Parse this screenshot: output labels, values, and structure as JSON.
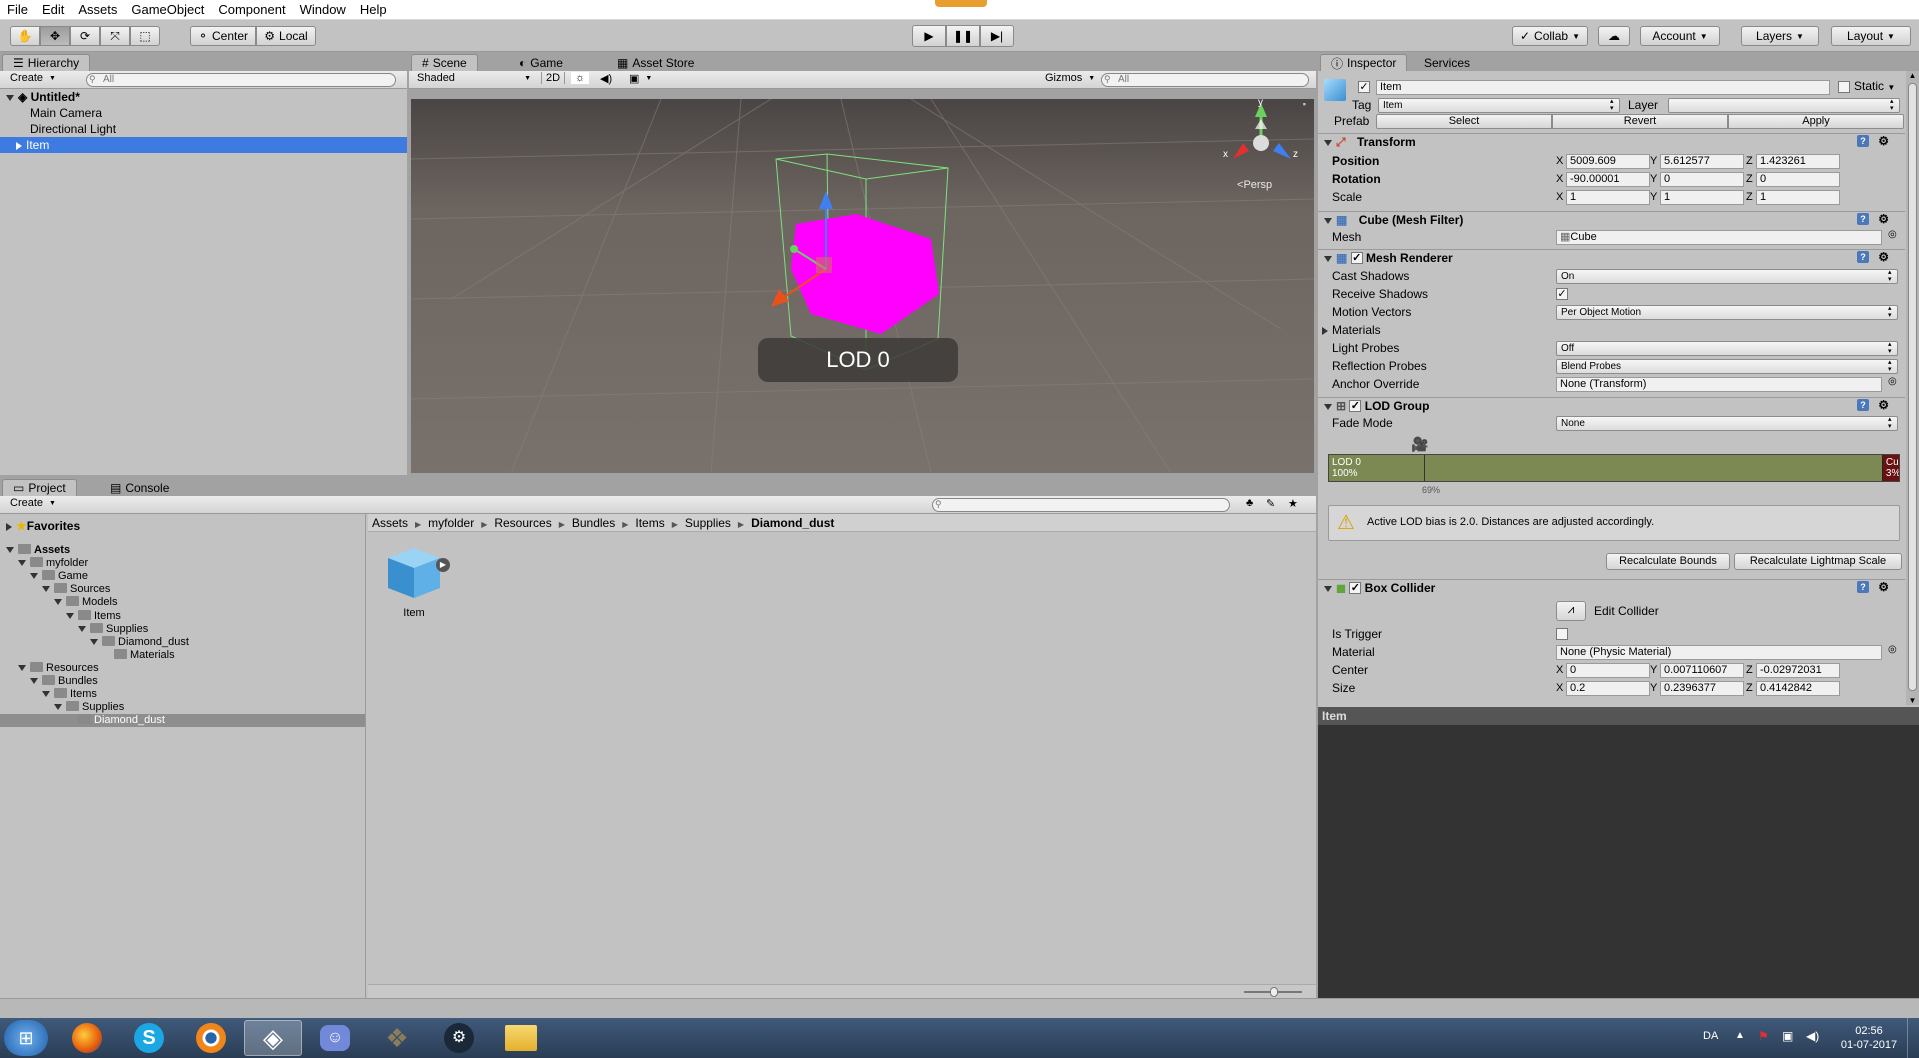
{
  "menu": [
    "File",
    "Edit",
    "Assets",
    "GameObject",
    "Component",
    "Window",
    "Help"
  ],
  "toolbar": {
    "pivot_label": "Center",
    "space_label": "Local",
    "collab_label": "Collab",
    "account_label": "Account",
    "layers_label": "Layers",
    "layout_label": "Layout"
  },
  "hierarchy": {
    "tab": "Hierarchy",
    "create": "Create",
    "search_placeholder": "All",
    "scene_name": "Untitled*",
    "items": [
      "Main Camera",
      "Directional Light",
      "Item"
    ],
    "selected": "Item"
  },
  "scene": {
    "tabs": [
      "Scene",
      "Game",
      "Asset Store"
    ],
    "shading": "Shaded",
    "mode_2d": "2D",
    "gizmos": "Gizmos",
    "search_placeholder": "All",
    "persp_label": "Persp",
    "lod_label": "LOD 0",
    "gizmo_axes": {
      "x": "x",
      "y": "y",
      "z": "z"
    },
    "object_color": "#ff00ff"
  },
  "project": {
    "tabs": [
      "Project",
      "Console"
    ],
    "create": "Create",
    "favorites": "Favorites",
    "tree": [
      {
        "label": "Assets",
        "depth": 0,
        "bold": true
      },
      {
        "label": "myfolder",
        "depth": 1
      },
      {
        "label": "Game",
        "depth": 2
      },
      {
        "label": "Sources",
        "depth": 3
      },
      {
        "label": "Models",
        "depth": 4
      },
      {
        "label": "Items",
        "depth": 5
      },
      {
        "label": "Supplies",
        "depth": 6
      },
      {
        "label": "Diamond_dust",
        "depth": 7
      },
      {
        "label": "Materials",
        "depth": 8
      },
      {
        "label": "Resources",
        "depth": 1
      },
      {
        "label": "Bundles",
        "depth": 2
      },
      {
        "label": "Items",
        "depth": 3
      },
      {
        "label": "Supplies",
        "depth": 4
      },
      {
        "label": "Diamond_dust",
        "depth": 5
      }
    ],
    "breadcrumb": [
      "Assets",
      "myfolder",
      "Resources",
      "Bundles",
      "Items",
      "Supplies",
      "Diamond_dust"
    ],
    "asset_name": "Item"
  },
  "inspector": {
    "tabs": [
      "Inspector",
      "Services"
    ],
    "object_name": "Item",
    "static_label": "Static",
    "tag_label": "Tag",
    "tag_value": "Item",
    "layer_label": "Layer",
    "layer_value": "",
    "prefab_label": "Prefab",
    "prefab_buttons": [
      "Select",
      "Revert",
      "Apply"
    ],
    "transform": {
      "title": "Transform",
      "position_label": "Position",
      "rotation_label": "Rotation",
      "scale_label": "Scale",
      "position": {
        "x": "5009.609",
        "y": "5.612577",
        "z": "1.423261"
      },
      "rotation": {
        "x": "-90.00001",
        "y": "0",
        "z": "0"
      },
      "scale": {
        "x": "1",
        "y": "1",
        "z": "1"
      }
    },
    "mesh_filter": {
      "title": "Cube (Mesh Filter)",
      "mesh_label": "Mesh",
      "mesh_value": "Cube"
    },
    "mesh_renderer": {
      "title": "Mesh Renderer",
      "cast_shadows_label": "Cast Shadows",
      "cast_shadows": "On",
      "receive_shadows_label": "Receive Shadows",
      "motion_vectors_label": "Motion Vectors",
      "motion_vectors": "Per Object Motion",
      "materials_label": "Materials",
      "light_probes_label": "Light Probes",
      "light_probes": "Off",
      "reflection_probes_label": "Reflection Probes",
      "reflection_probes": "Blend Probes",
      "anchor_override_label": "Anchor Override",
      "anchor_override": "None (Transform)"
    },
    "lod_group": {
      "title": "LOD Group",
      "fade_mode_label": "Fade Mode",
      "fade_mode": "None",
      "lod0_label": "LOD 0",
      "lod0_percent": "100%",
      "culled_label": "Culled",
      "culled_percent": "3%",
      "lod0_fraction": 0.97,
      "marker_percent": "69%",
      "warning": "Active LOD bias is 2.0. Distances are adjusted accordingly.",
      "recalc_bounds": "Recalculate Bounds",
      "recalc_lightmap": "Recalculate Lightmap Scale"
    },
    "box_collider": {
      "title": "Box Collider",
      "edit_collider": "Edit Collider",
      "is_trigger_label": "Is Trigger",
      "material_label": "Material",
      "material": "None (Physic Material)",
      "center_label": "Center",
      "center": {
        "x": "0",
        "y": "0.007110607",
        "z": "-0.02972031"
      },
      "size_label": "Size",
      "size": {
        "x": "0.2",
        "y": "0.2396377",
        "z": "0.4142842"
      }
    },
    "preview_title": "Item"
  },
  "taskbar": {
    "lang": "DA",
    "time": "02:56",
    "date": "01-07-2017",
    "apps": [
      "start-orb",
      "firefox",
      "skype",
      "blender",
      "unity",
      "discord",
      "gimp",
      "steam",
      "explorer"
    ]
  }
}
